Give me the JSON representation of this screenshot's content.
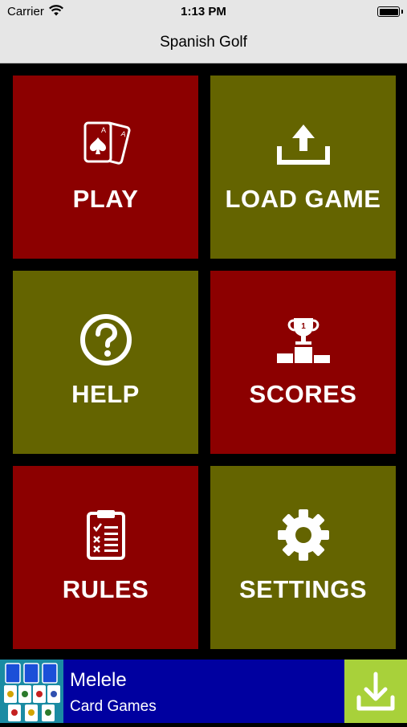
{
  "status_bar": {
    "carrier": "Carrier",
    "time": "1:13 PM"
  },
  "nav": {
    "title": "Spanish Golf"
  },
  "menu": {
    "tiles": [
      {
        "label": "PLAY",
        "icon": "cards-icon",
        "color": "#8c0000"
      },
      {
        "label": "LOAD GAME",
        "icon": "upload-icon",
        "color": "#646400"
      },
      {
        "label": "HELP",
        "icon": "help-icon",
        "color": "#646400"
      },
      {
        "label": "SCORES",
        "icon": "trophy-podium-icon",
        "color": "#8c0000"
      },
      {
        "label": "RULES",
        "icon": "clipboard-icon",
        "color": "#8c0000"
      },
      {
        "label": "SETTINGS",
        "icon": "gear-icon",
        "color": "#646400"
      }
    ]
  },
  "ad": {
    "app_name": "Melele",
    "subtitle": "Card Games"
  }
}
